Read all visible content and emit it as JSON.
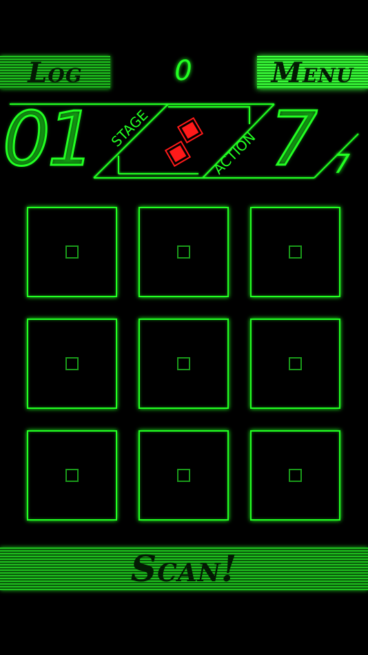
{
  "header": {
    "log_label": "Log",
    "counter": "0",
    "menu_label": "Menu"
  },
  "hud": {
    "stage_label": "STAGE",
    "stage_value": "01",
    "action_label": "ACTION",
    "action_value": "7",
    "action_max": "7",
    "lives_remaining": 2
  },
  "grid": {
    "rows": 3,
    "cols": 3
  },
  "footer": {
    "scan_label": "Scan!"
  },
  "colors": {
    "accent": "#22ff22",
    "life": "#ff1a1a",
    "background": "#000000"
  }
}
